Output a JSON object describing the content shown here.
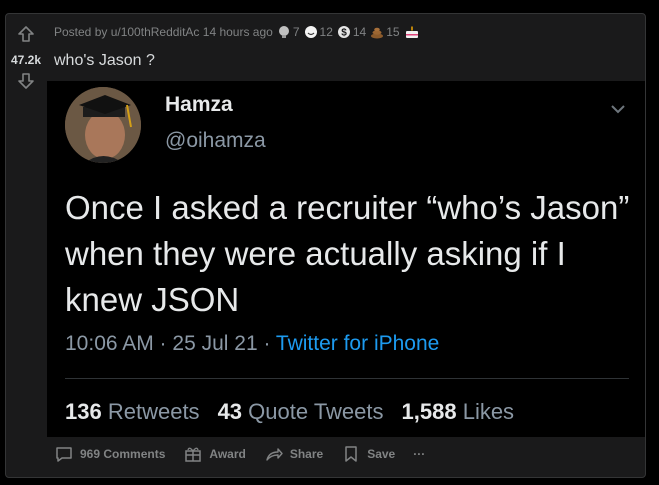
{
  "vote": {
    "score": "47.2k"
  },
  "meta": {
    "posted_by": "Posted by u/100thRedditAc 14 hours ago",
    "awards": [
      {
        "icon": "silver-award-icon",
        "count": "7"
      },
      {
        "icon": "wholesome-award-icon",
        "count": "12"
      },
      {
        "icon": "gold-dollar-award-icon",
        "count": "14"
      },
      {
        "icon": "poop-award-icon",
        "count": "15"
      },
      {
        "icon": "cake-award-icon",
        "count": ""
      }
    ]
  },
  "post": {
    "title": "who's Jason ?"
  },
  "tweet": {
    "name": "Hamza",
    "handle": "@oihamza",
    "text": "Once I asked a recruiter “who’s Jason” when they were actually asking if I knew JSON",
    "time": "10:06 AM · 25 Jul 21 ·",
    "client": "Twitter for iPhone",
    "retweets": "136",
    "retweets_label": "Retweets",
    "quotes": "43",
    "quotes_label": "Quote Tweets",
    "likes": "1,588",
    "likes_label": "Likes"
  },
  "actions": {
    "comments": "969 Comments",
    "award": "Award",
    "share": "Share",
    "save": "Save",
    "more": "···"
  }
}
